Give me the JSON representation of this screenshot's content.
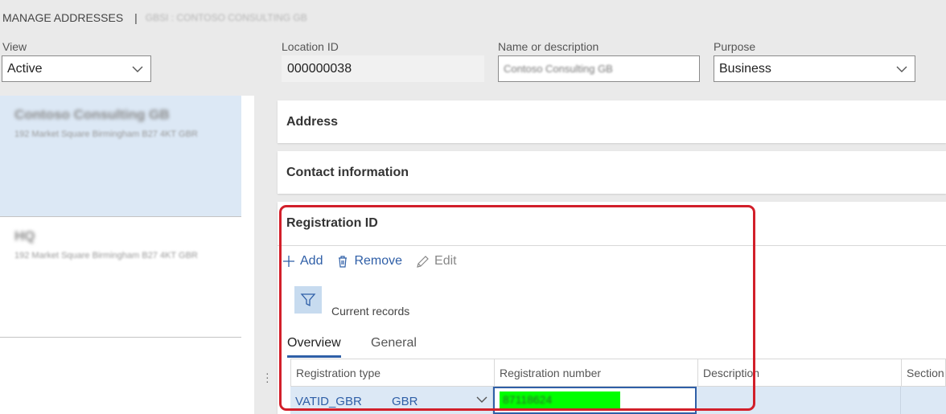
{
  "header": {
    "title": "MANAGE ADDRESSES",
    "separator": "|",
    "subtitle": "GBSI : CONTOSO CONSULTING GB"
  },
  "fields": {
    "view": {
      "label": "View",
      "value": "Active"
    },
    "location_id": {
      "label": "Location ID",
      "value": "000000038"
    },
    "name": {
      "label": "Name or description",
      "value": "Contoso Consulting GB"
    },
    "purpose": {
      "label": "Purpose",
      "value": "Business"
    }
  },
  "address_list": [
    {
      "name": "Contoso Consulting GB",
      "address": "192 Market Square Birmingham B27 4KT GBR",
      "selected": true
    },
    {
      "name": "HQ",
      "address": "192 Market Square Birmingham B27 4KT GBR",
      "selected": false
    }
  ],
  "fasttabs": {
    "address": "Address",
    "contact": "Contact information",
    "registration": "Registration ID"
  },
  "toolbar": {
    "add": "Add",
    "remove": "Remove",
    "edit": "Edit"
  },
  "filter": {
    "label": "Current records"
  },
  "tabs": {
    "overview": "Overview",
    "general": "General"
  },
  "grid": {
    "columns": [
      "Registration type",
      "Registration number",
      "Description",
      "Section"
    ],
    "rows": [
      {
        "type": "VATID_GBR",
        "country": "GBR",
        "number": "87118624",
        "description": "",
        "section": ""
      }
    ]
  },
  "colors": {
    "accent": "#2f5fa7",
    "selected": "#dce8f5",
    "highlight": "#00ff00",
    "annotation": "#d21f2a"
  }
}
